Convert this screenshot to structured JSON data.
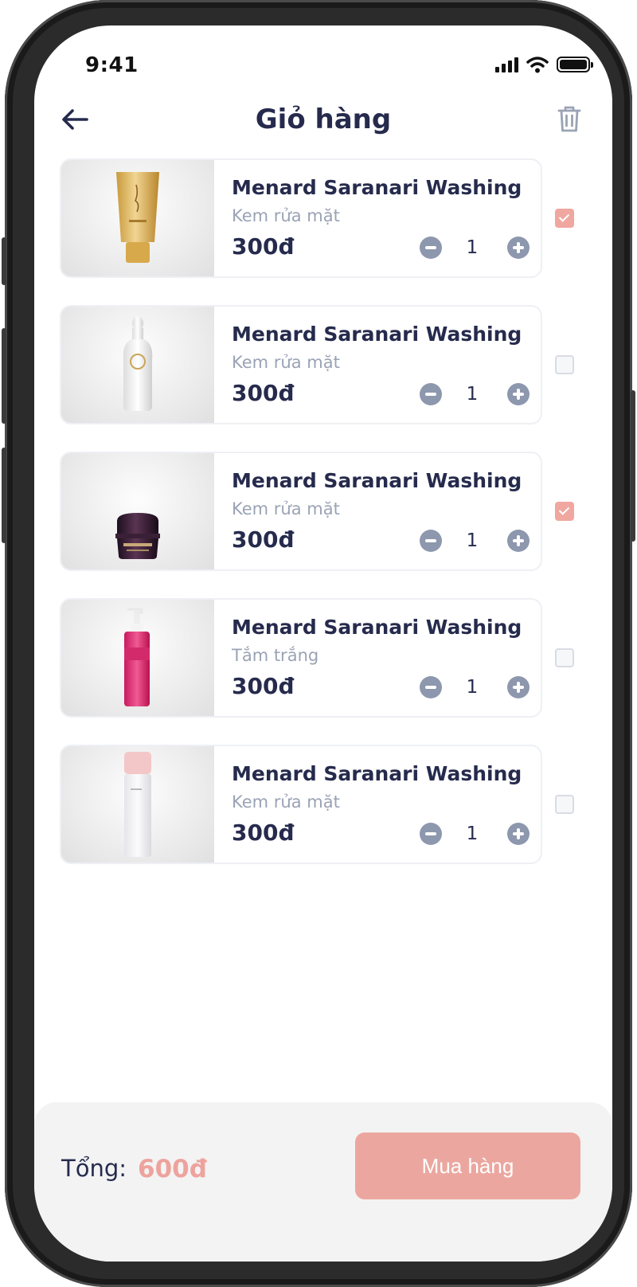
{
  "status_bar": {
    "time": "9:41"
  },
  "header": {
    "title": "Giỏ hàng"
  },
  "cart": {
    "items": [
      {
        "name": "Menard Saranari Washing",
        "category": "Kem rửa mặt",
        "price": "300đ",
        "quantity": "1",
        "checked": true,
        "image": "gold-tube"
      },
      {
        "name": "Menard Saranari Washing",
        "category": "Kem rửa mặt",
        "price": "300đ",
        "quantity": "1",
        "checked": false,
        "image": "white-bottle"
      },
      {
        "name": "Menard Saranari Washing",
        "category": "Kem rửa mặt",
        "price": "300đ",
        "quantity": "1",
        "checked": true,
        "image": "purple-jar"
      },
      {
        "name": "Menard Saranari Washing",
        "category": "Tắm trắng",
        "price": "300đ",
        "quantity": "1",
        "checked": false,
        "image": "pink-pump-bottle"
      },
      {
        "name": "Menard Saranari Washing",
        "category": "Kem rửa mặt",
        "price": "300đ",
        "quantity": "1",
        "checked": false,
        "image": "clear-toner-bottle"
      }
    ]
  },
  "footer": {
    "total_label": "Tổng:",
    "total_value": "600đ",
    "buy_label": "Mua hàng"
  },
  "colors": {
    "accent": "#eba79f",
    "text_primary": "#262b4d",
    "text_secondary": "#9aa3b5",
    "qty_button": "#8d97ad"
  }
}
